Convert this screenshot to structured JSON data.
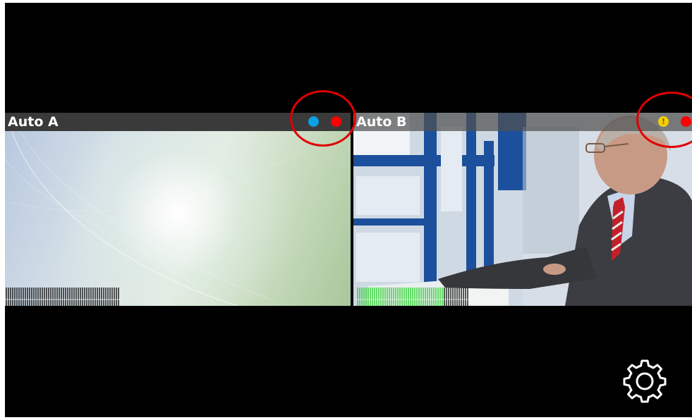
{
  "tiles": [
    {
      "title": "Auto A",
      "status_dots": [
        {
          "color": "#0aa0e6",
          "icon": "status-dot-blue"
        },
        {
          "color": "#ff0000",
          "icon": "status-dot-red"
        }
      ]
    },
    {
      "title": "Auto B",
      "status_dots": [
        {
          "color": "#f5d000",
          "icon": "warning-dot-yellow",
          "symbol": "!"
        },
        {
          "color": "#ff0000",
          "icon": "status-dot-red"
        }
      ]
    }
  ],
  "settings": {
    "icon": "gear-icon"
  },
  "colors": {
    "background": "#000000",
    "highlight_ring": "#e00000",
    "meter_active": "#3ad43a",
    "meter_idle": "#ffffff"
  }
}
